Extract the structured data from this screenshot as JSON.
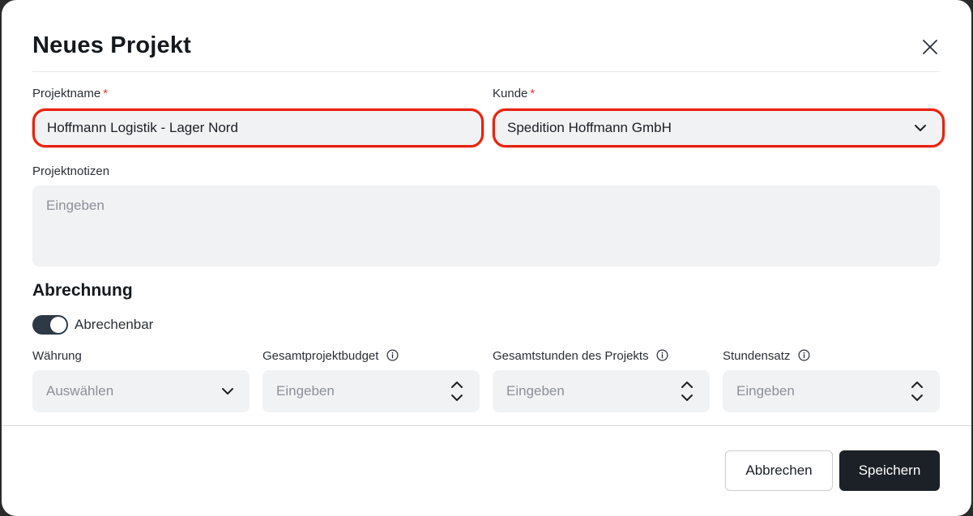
{
  "modal": {
    "title": "Neues Projekt"
  },
  "form": {
    "project_name": {
      "label": "Projektname",
      "required_mark": "*",
      "value": "Hoffmann Logistik - Lager Nord"
    },
    "customer": {
      "label": "Kunde",
      "required_mark": "*",
      "value": "Spedition Hoffmann GmbH"
    },
    "notes": {
      "label": "Projektnotizen",
      "placeholder": "Eingeben"
    }
  },
  "billing": {
    "title": "Abrechnung",
    "billable_toggle": {
      "label": "Abrechenbar",
      "on": true
    },
    "currency": {
      "label": "Währung",
      "placeholder": "Auswählen"
    },
    "budget": {
      "label": "Gesamtprojektbudget",
      "placeholder": "Eingeben"
    },
    "hours": {
      "label": "Gesamtstunden des Projekts",
      "placeholder": "Eingeben"
    },
    "rate": {
      "label": "Stundensatz",
      "placeholder": "Eingeben"
    }
  },
  "footer": {
    "cancel_label": "Abbrechen",
    "save_label": "Speichern"
  },
  "colors": {
    "highlight": "#e8220e",
    "primary_button": "#1b2127",
    "toggle_on": "#2d3a45",
    "required": "#e5332a"
  },
  "icons": [
    "close-icon",
    "chevron-down-icon",
    "stepper-icon",
    "info-icon"
  ]
}
